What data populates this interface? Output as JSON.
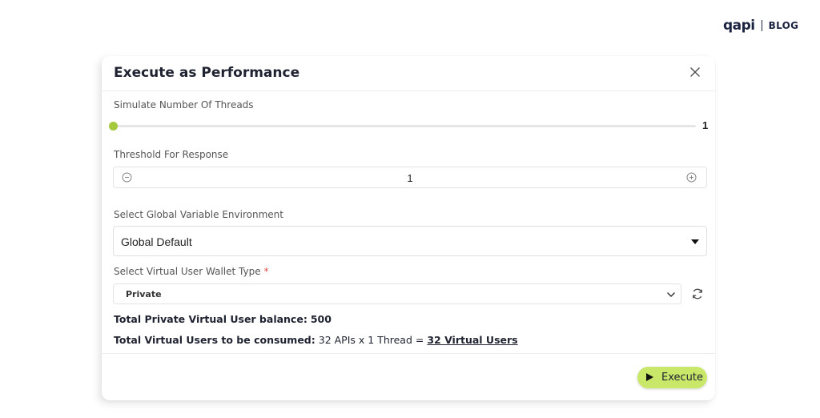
{
  "brand": {
    "logo_text": "qapi",
    "blog_label": "BLOG"
  },
  "modal": {
    "title": "Execute as Performance",
    "threads": {
      "label": "Simulate Number Of Threads",
      "value": "1",
      "fraction": 0
    },
    "threshold": {
      "label": "Threshold For Response",
      "value": "1"
    },
    "environment": {
      "label": "Select Global Variable Environment",
      "selected": "Global Default"
    },
    "wallet": {
      "label": "Select Virtual User Wallet Type",
      "required_mark": "*",
      "selected": "Private"
    },
    "balance": {
      "label": "Total Private Virtual User balance:",
      "value": "500"
    },
    "consumption": {
      "label": "Total Virtual Users to be consumed:",
      "formula": "32 APIs x 1 Thread =",
      "result": "32 Virtual Users"
    },
    "execute_label": "Execute"
  },
  "colors": {
    "accent": "#a4c93d",
    "button": "#c9e86a",
    "brand": "#1c2340",
    "required": "#e04b4b"
  }
}
